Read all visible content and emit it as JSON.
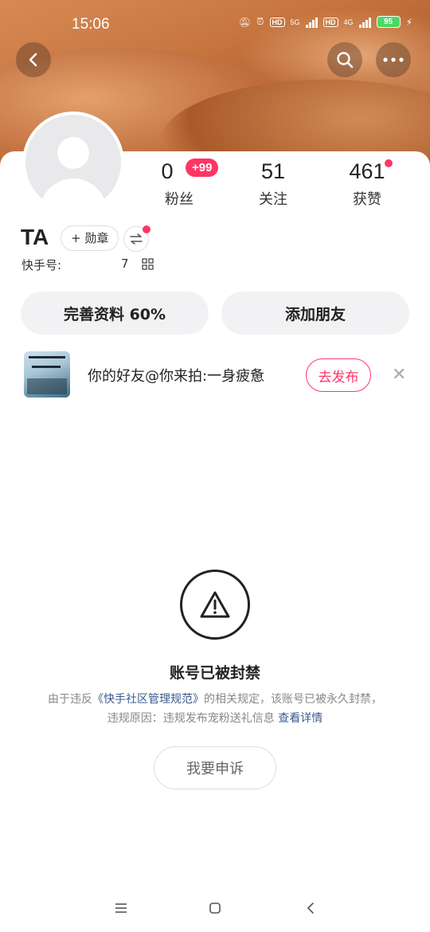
{
  "status_bar": {
    "time": "15:06",
    "network1": "5G",
    "network2": "4G",
    "hd": "HD",
    "battery": "95"
  },
  "profile": {
    "username": "TA",
    "medal_label": "+ 勋章",
    "id_label": "快手号:",
    "id_value": "7",
    "stats": {
      "fans_count": "0",
      "fans_badge": "+99",
      "fans_label": "粉丝",
      "follow_count": "51",
      "follow_label": "关注",
      "likes_count": "461",
      "likes_label": "获赞"
    }
  },
  "actions": {
    "complete_label": "完善资料 60%",
    "add_friend_label": "添加朋友"
  },
  "suggestion": {
    "text": "你的好友@你来拍:一身疲惫",
    "publish_label": "去发布",
    "close_symbol": "✕"
  },
  "ban": {
    "title": "账号已被封禁",
    "desc_prefix": "由于违反",
    "desc_link": "《快手社区管理规范》",
    "desc_middle": "的相关规定，该账号已被永久封禁，违规原因：违规发布宠粉送礼信息",
    "desc_more": "查看详情",
    "appeal_label": "我要申诉"
  },
  "colors": {
    "accent": "#fe3666",
    "link": "#3a5a8c"
  },
  "icons": [
    "back-arrow-icon",
    "search-icon",
    "more-icon",
    "swap-icon",
    "qr-code-icon",
    "warning-icon",
    "menu-icon",
    "home-icon",
    "back-icon"
  ]
}
